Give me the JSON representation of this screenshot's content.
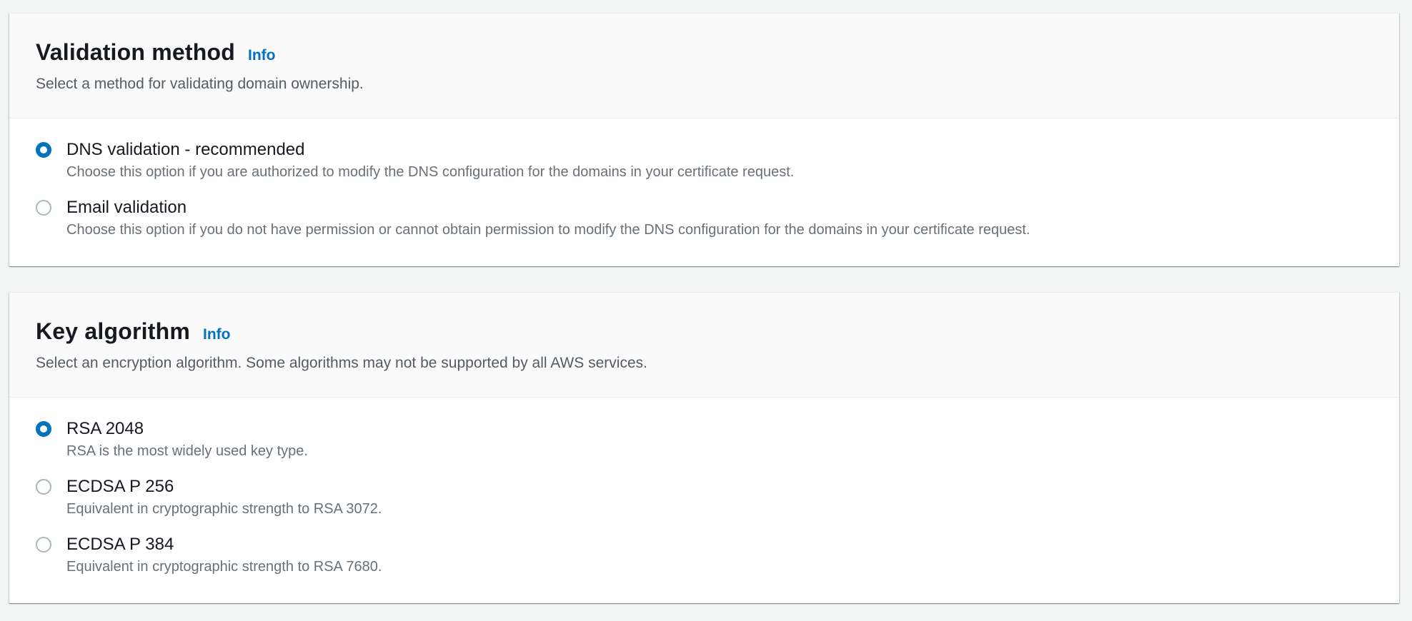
{
  "validation_method": {
    "title": "Validation method",
    "info_label": "Info",
    "description": "Select a method for validating domain ownership.",
    "options": [
      {
        "label": "DNS validation - recommended",
        "description": "Choose this option if you are authorized to modify the DNS configuration for the domains in your certificate request.",
        "selected": true
      },
      {
        "label": "Email validation",
        "description": "Choose this option if you do not have permission or cannot obtain permission to modify the DNS configuration for the domains in your certificate request.",
        "selected": false
      }
    ]
  },
  "key_algorithm": {
    "title": "Key algorithm",
    "info_label": "Info",
    "description": "Select an encryption algorithm. Some algorithms may not be supported by all AWS services.",
    "options": [
      {
        "label": "RSA 2048",
        "description": "RSA is the most widely used key type.",
        "selected": true
      },
      {
        "label": "ECDSA P 256",
        "description": "Equivalent in cryptographic strength to RSA 3072.",
        "selected": false
      },
      {
        "label": "ECDSA P 384",
        "description": "Equivalent in cryptographic strength to RSA 7680.",
        "selected": false
      }
    ]
  },
  "colors": {
    "accent": "#0073bb",
    "background": "#f2f3f3",
    "header_bg": "#fafafa",
    "text_primary": "#16191f",
    "text_secondary": "#687078"
  }
}
